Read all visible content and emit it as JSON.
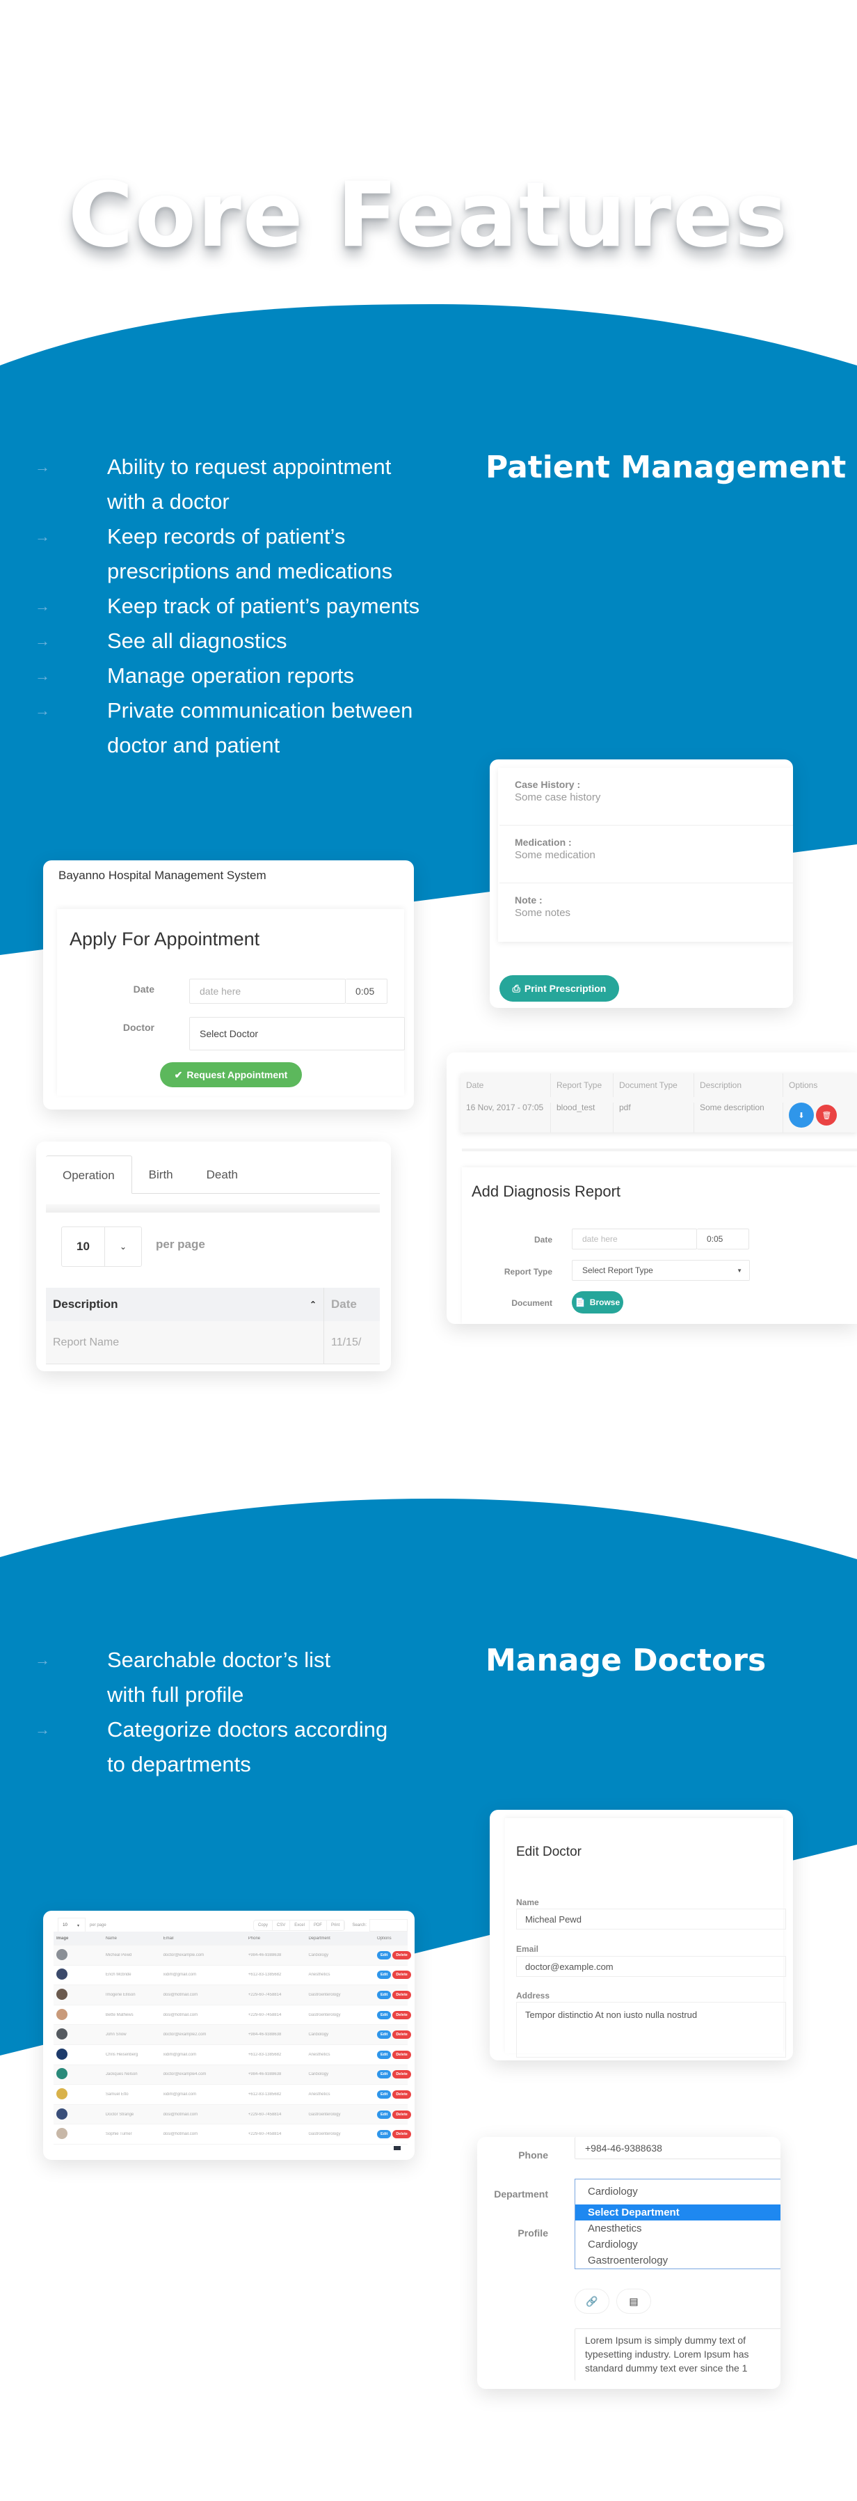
{
  "colors": {
    "brand_blue": "#0086c0",
    "arrow": "#6fb3dc",
    "teal_button": "#26a69a",
    "green_button": "#5cb85c",
    "blue_button": "#2f96ea",
    "red_button": "#ea4343",
    "dropdown_selected": "#1e88f0"
  },
  "hero": {
    "title": "Core Features"
  },
  "patient_section": {
    "title": "Patient Management",
    "features": [
      {
        "icon": "arrow-right-icon",
        "lines": [
          "Ability to request appointment",
          "with a doctor"
        ]
      },
      {
        "icon": "arrow-right-icon",
        "lines": [
          "Keep records of patient’s",
          "prescriptions and medications"
        ]
      },
      {
        "icon": "arrow-right-icon",
        "lines": [
          "Keep track of patient’s payments"
        ]
      },
      {
        "icon": "arrow-right-icon",
        "lines": [
          "See all diagnostics"
        ]
      },
      {
        "icon": "arrow-right-icon",
        "lines": [
          "Manage operation reports"
        ]
      },
      {
        "icon": "arrow-right-icon",
        "lines": [
          "Private communication between",
          "doctor and patient"
        ]
      }
    ],
    "prescription": {
      "rows": [
        {
          "label": "Case History :",
          "value": "Some case history"
        },
        {
          "label": "Medication :",
          "value": "Some medication"
        },
        {
          "label": "Note :",
          "value": "Some notes"
        }
      ],
      "print_button": "Print Prescription"
    },
    "appointment": {
      "app_name": "Bayanno Hospital Management System",
      "title": "Apply For Appointment",
      "date_label": "Date",
      "date_placeholder": "date here",
      "time_value": "0:05",
      "doctor_label": "Doctor",
      "doctor_select": "Select Doctor",
      "submit_button": "Request Appointment"
    },
    "reports": {
      "tabs": [
        "Operation",
        "Birth",
        "Death"
      ],
      "active_tab": "Operation",
      "per_page_value": "10",
      "per_page_label": "per page",
      "columns": [
        "Description",
        "Date"
      ],
      "rows": [
        [
          "Report Name",
          "11/15/"
        ]
      ]
    },
    "diagnosis": {
      "columns": [
        "Date",
        "Report Type",
        "Document Type",
        "Description",
        "Options"
      ],
      "rows": [
        [
          "16 Nov, 2017 - 07:05",
          "blood_test",
          "pdf",
          "Some description"
        ]
      ],
      "form_title": "Add Diagnosis Report",
      "date_label": "Date",
      "date_placeholder": "date here",
      "time_value": "0:05",
      "report_type_label": "Report Type",
      "report_type_select": "Select Report Type",
      "document_label": "Document",
      "browse_button": "Browse"
    }
  },
  "doctors_section": {
    "title": "Manage Doctors",
    "features": [
      {
        "icon": "arrow-right-icon",
        "lines": [
          "Searchable doctor’s list",
          "with full profile"
        ]
      },
      {
        "icon": "arrow-right-icon",
        "lines": [
          "Categorize doctors according",
          "to departments"
        ]
      }
    ],
    "doctor_list": {
      "per_page_value": "10",
      "per_page_label": "per page",
      "export_buttons": [
        "Copy",
        "CSV",
        "Excel",
        "PDF",
        "Print"
      ],
      "search_label": "Search:",
      "columns": [
        "Image",
        "Name",
        "Email",
        "Phone",
        "Department",
        "Options"
      ],
      "edit_label": "Edit",
      "delete_label": "Delete",
      "rows": [
        {
          "name": "Micheal Pewd",
          "email": "doctor@example.com",
          "phone": "+984-46-9388638",
          "department": "Cardiology",
          "avatar_color": "#8a8f96"
        },
        {
          "name": "Erich Mcbride",
          "email": "xidim@gmail.com",
          "phone": "+612-83-1385682",
          "department": "Anesthetics",
          "avatar_color": "#3b4a6b"
        },
        {
          "name": "Imogene Ellison",
          "email": "dosi@hotmail.com",
          "phone": "+229-60-7458814",
          "department": "Gastroenterology",
          "avatar_color": "#6b5a4e"
        },
        {
          "name": "Bette Mathews",
          "email": "dosi@hotmail.com",
          "phone": "+229-60-7458814",
          "department": "Gastroenterology",
          "avatar_color": "#c99a7a"
        },
        {
          "name": "John Snow",
          "email": "doctor@example2.com",
          "phone": "+984-46-9388638",
          "department": "Cardiology",
          "avatar_color": "#555a60"
        },
        {
          "name": "Chris Heisenberg",
          "email": "xidim@gmail.com",
          "phone": "+612-83-1385682",
          "department": "Anesthetics",
          "avatar_color": "#1d3b6b"
        },
        {
          "name": "Jackques Nelson",
          "email": "doctor@example4.com",
          "phone": "+984-46-9388638",
          "department": "Cardiology",
          "avatar_color": "#2a8a7a"
        },
        {
          "name": "Samuel Etto",
          "email": "xidim@gmail.com",
          "phone": "+612-83-1385682",
          "department": "Anesthetics",
          "avatar_color": "#d9b24a"
        },
        {
          "name": "Doctor Strange",
          "email": "dosi@hotmail.com",
          "phone": "+229-60-7458814",
          "department": "Gastroenterology",
          "avatar_color": "#3a4f7a"
        },
        {
          "name": "Sophie Turner",
          "email": "dosi@hotmail.com",
          "phone": "+229-60-7458814",
          "department": "Gastroenterology",
          "avatar_color": "#c7b7a7"
        }
      ]
    },
    "edit_doctor": {
      "title": "Edit Doctor",
      "name_label": "Name",
      "name_value": "Micheal Pewd",
      "email_label": "Email",
      "email_value": "doctor@example.com",
      "address_label": "Address",
      "address_value": "Tempor distinctio At non iusto nulla nostrud"
    },
    "doctor_profile": {
      "phone_label": "Phone",
      "phone_value": "+984-46-9388638",
      "department_label": "Department",
      "department_value": "Cardiology",
      "department_options": [
        "Select Department",
        "Anesthetics",
        "Cardiology",
        "Gastroenterology"
      ],
      "department_highlighted": "Select Department",
      "profile_label": "Profile",
      "profile_text": "Lorem Ipsum is simply dummy text of typesetting industry. Lorem Ipsum has standard dummy text ever since the 1"
    }
  }
}
